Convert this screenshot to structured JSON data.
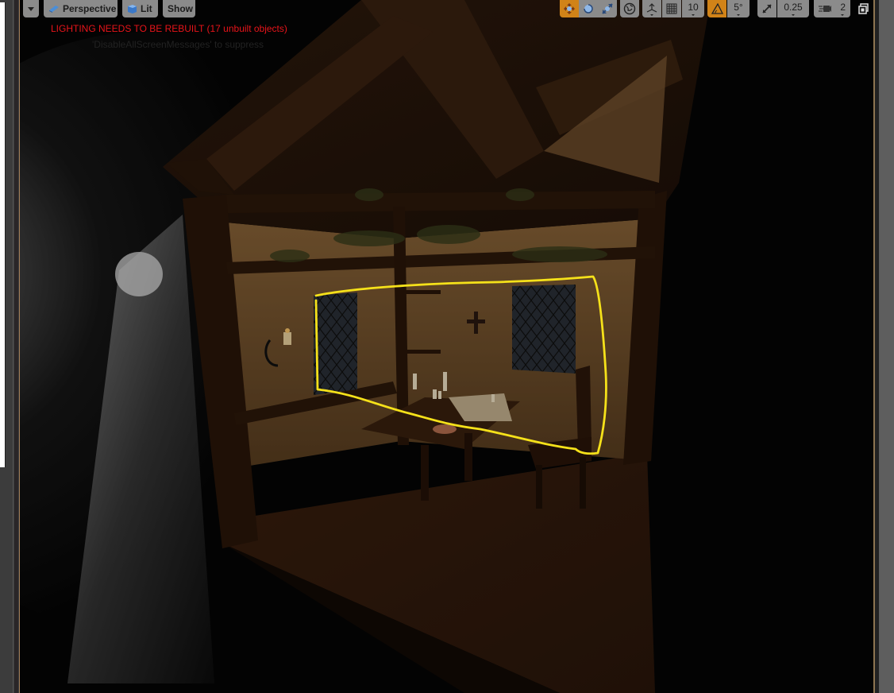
{
  "viewport": {
    "menu_dropdown_icon": "chevron-down-icon",
    "view_mode_label": "Perspective",
    "view_mode_icon": "perspective-cube-icon",
    "lighting_mode_label": "Lit",
    "lighting_mode_icon": "lit-sphere-icon",
    "show_label": "Show",
    "messages": {
      "warning": "LIGHTING NEEDS TO BE REBUILT (17 unbuilt objects)",
      "hint": "'DisableAllScreenMessages' to suppress"
    }
  },
  "transform_toolbar": {
    "tools": [
      {
        "name": "translate",
        "icon": "move-arrows-icon",
        "active": true
      },
      {
        "name": "rotate",
        "icon": "rotate-icon",
        "active": false
      },
      {
        "name": "scale",
        "icon": "scale-icon",
        "active": false
      }
    ],
    "coordinate_system_icon": "globe-icon",
    "surface_snap_icon": "surface-snap-icon",
    "grid_snap": {
      "icon": "grid-icon",
      "value": "10"
    },
    "rotation_snap": {
      "icon": "angle-icon",
      "value": "5°",
      "active": true
    },
    "scale_snap": {
      "icon": "scale-arrow-icon",
      "value": "0.25"
    },
    "camera_speed": {
      "icon": "camera-speed-icon",
      "value": "2"
    },
    "maximize_icon": "restore-window-icon"
  },
  "annotation": {
    "shape": "hand-drawn rectangle",
    "color": "#f5e11a",
    "target": "windows and desk area"
  },
  "colors": {
    "accent_orange": "#d18318",
    "warning_red": "#e8141a",
    "button_gray": "#8b8b8b"
  }
}
